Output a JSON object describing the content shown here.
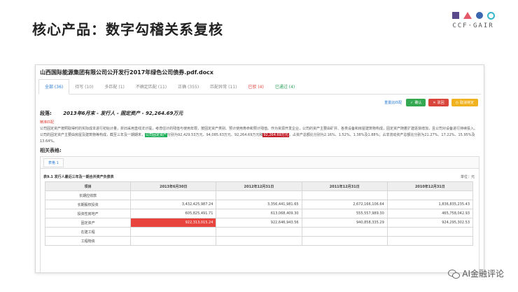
{
  "slide": {
    "title": "核心产品：数字勾稽关系复核"
  },
  "brand": {
    "name": "CCF·GAIR"
  },
  "document": {
    "title": "山西国际能源集团有限公司公开发行2017年绿色公司债券.pdf.docx",
    "tabs": [
      {
        "label": "全部 (36)",
        "state": "active"
      },
      {
        "label": "待写 (10)",
        "state": "normal"
      },
      {
        "label": "多匹配 (1)",
        "state": "normal"
      },
      {
        "label": "不确定匹配 (11)",
        "state": "normal"
      },
      {
        "label": "正确 (355)",
        "state": "normal"
      },
      {
        "label": "匹配异常 (11)",
        "state": "normal"
      },
      {
        "label": "已驳 (4)",
        "state": "red"
      },
      {
        "label": "已通过 (4)",
        "state": "green"
      }
    ],
    "actions": {
      "link": "重置此匹配",
      "approve": "确认",
      "reject": "驳回",
      "cancel": "取消待定"
    },
    "paragraph": {
      "label": "段落:",
      "meta": "2013年6月末 - 发行人 - 固定资产 - 92,264.69万元",
      "mark": "精准匹配",
      "text_before": "公司固定资产按照取得时的实际成本进行初始计量，折旧采用直线法计提，考虑估计的残值与使用年限，按固定资产类别、预计使用寿命和预计残值。作为资源开发企业，公司的资产主要由矿井、各类设备和房屋建筑物构成，固定资产随着扩建逐渐增加，且公司对设备进行持续投入。公司的固定资产主要由房屋及建筑物等构成，截至三年及一期期末，",
      "highlight_green": "公司固定资产",
      "text_middle": "分别为92,429.53万元、94,085.63万元、92,264.69万元和",
      "highlight_red": "92,264.69万元",
      "text_after": "，占资产总额比分别为2.16%、1.52%、1.38%及1.88%；占非流动资产总额比分别为21.27%、17.22%、15.95%及13.64%。"
    },
    "related": {
      "label": "相关表格:",
      "table_tab": "表格 1",
      "table_caption": "表9.1 发行人最近三年及一期合并资产负债表",
      "unit": "单位：元",
      "columns": [
        "项目",
        "2013年6月30日",
        "2012年12月31日",
        "2011年12月31日",
        "2010年12月31日"
      ],
      "rows": [
        {
          "label": "长期应收款",
          "values": [
            "",
            "",
            "",
            ""
          ],
          "highlight": -1
        },
        {
          "label": "长期股权投资",
          "values": [
            "3,432,425,987.24",
            "3,356,441,981.65",
            "2,672,166,106.64",
            "1,836,835,235.43"
          ],
          "highlight": -1
        },
        {
          "label": "投资性房地产",
          "values": [
            "605,825,491.71",
            "613,068,409.30",
            "555,557,989.30",
            "465,758,042.93"
          ],
          "highlight": -1
        },
        {
          "label": "固定资产",
          "values": [
            "922,313,015.24",
            "922,646,943.56",
            "940,858,335.29",
            "924,295,302.53"
          ],
          "highlight": 0
        },
        {
          "label": "在建工程",
          "values": [
            "",
            "",
            "",
            ""
          ],
          "highlight": -1
        },
        {
          "label": "工程物资",
          "values": [
            "",
            "",
            "",
            ""
          ],
          "highlight": -1
        }
      ]
    }
  },
  "watermark": {
    "text": "AI金融评论"
  }
}
